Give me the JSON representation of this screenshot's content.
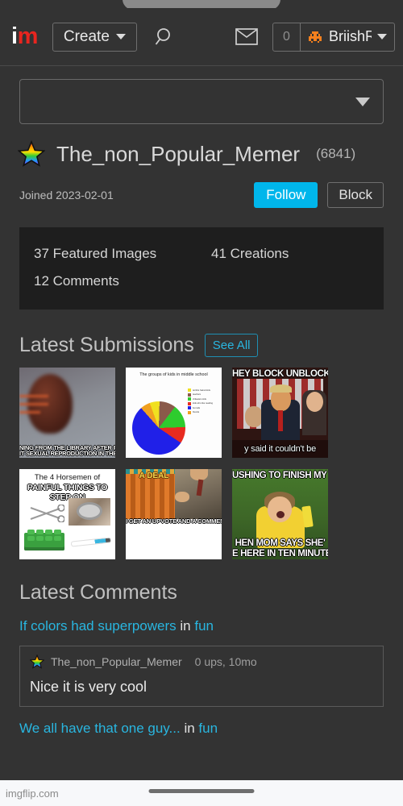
{
  "browser": {
    "url_label": "imgflip.com",
    "home_indicator": "home-indicator"
  },
  "header": {
    "logo_i": "i",
    "logo_m": "m",
    "create_label": "Create",
    "search_icon": "search-icon",
    "mail_icon": "mail-icon",
    "notification_count": "0",
    "account_name": "BriishRap",
    "account_avatar_icon": "invader-avatar-icon",
    "caret_icon": "chevron-down-icon"
  },
  "site_select": {
    "value": "",
    "caret_icon": "chevron-down-icon"
  },
  "profile": {
    "badge_icon": "rainbow-star-icon",
    "username": "The_non_Popular_Memer",
    "points": "(6841)",
    "joined": "Joined 2023-02-01",
    "follow_label": "Follow",
    "block_label": "Block",
    "follow_color": "#00b6eb"
  },
  "stats": [
    "37 Featured Images",
    "41 Creations",
    "12 Comments"
  ],
  "submissions": {
    "title": "Latest Submissions",
    "see_all_label": "See All",
    "items": [
      {
        "name": "running-from-library-meme",
        "caption_top": "",
        "caption_line1": "NING FROM THE LIBRARY AFTER PUTTI",
        "caption_line2": "IT SEXUAL REPRODUCTION IN THE HUM"
      },
      {
        "name": "middle-school-groups-pie-chart-meme",
        "chart_title": "The groups of kids in middle school",
        "legend": [
          "terrible haired kids",
          "teachers",
          "chileaters kids",
          "kids who like reading",
          "fun kids",
          "friends"
        ]
      },
      {
        "name": "trump-block-unblocked-meme",
        "caption_top": "HEY BLOCK UNBLOCKED",
        "caption_bottom": "y said it couldn't be"
      },
      {
        "name": "four-horsemen-painful-things-meme",
        "caption_line1": "The 4 Horsemen of",
        "caption_line2": "PAINFUL THINGS TO STEP ON"
      },
      {
        "name": "a-deal-upvote-meme",
        "caption_top": "A DEAL",
        "caption_bottom": "I GET AN UPVOTE AND A COMMENT"
      },
      {
        "name": "chubby-bubbles-girl-chores-meme",
        "caption_top": "USHING TO FINISH MY CH",
        "caption_line2": "HEN MOM SAYS SHE'",
        "caption_line3": "E HERE IN TEN MINUTE"
      }
    ]
  },
  "comments": {
    "title": "Latest Comments",
    "entries": [
      {
        "post_title": "If colors had superpowers",
        "in_word": "in",
        "stream": "fun",
        "author": "The_non_Popular_Memer",
        "author_badge_icon": "rainbow-star-icon",
        "meta": "0 ups, 10mo",
        "body": "Nice it is very cool"
      },
      {
        "post_title": "We all have that one guy...",
        "in_word": "in",
        "stream": "fun"
      }
    ]
  },
  "chart_data": {
    "type": "pie",
    "title": "The groups of kids in middle school",
    "categories": [
      "terrible haired kids",
      "teachers",
      "chileaters kids",
      "kids who like reading",
      "fun kids",
      "friends"
    ],
    "values": [
      6,
      10,
      14,
      10,
      54,
      6
    ],
    "colors": [
      "#f0e020",
      "#8a5a4a",
      "#2ecc2e",
      "#e82b20",
      "#2020e8",
      "#f0a020"
    ],
    "legend_position": "right"
  }
}
